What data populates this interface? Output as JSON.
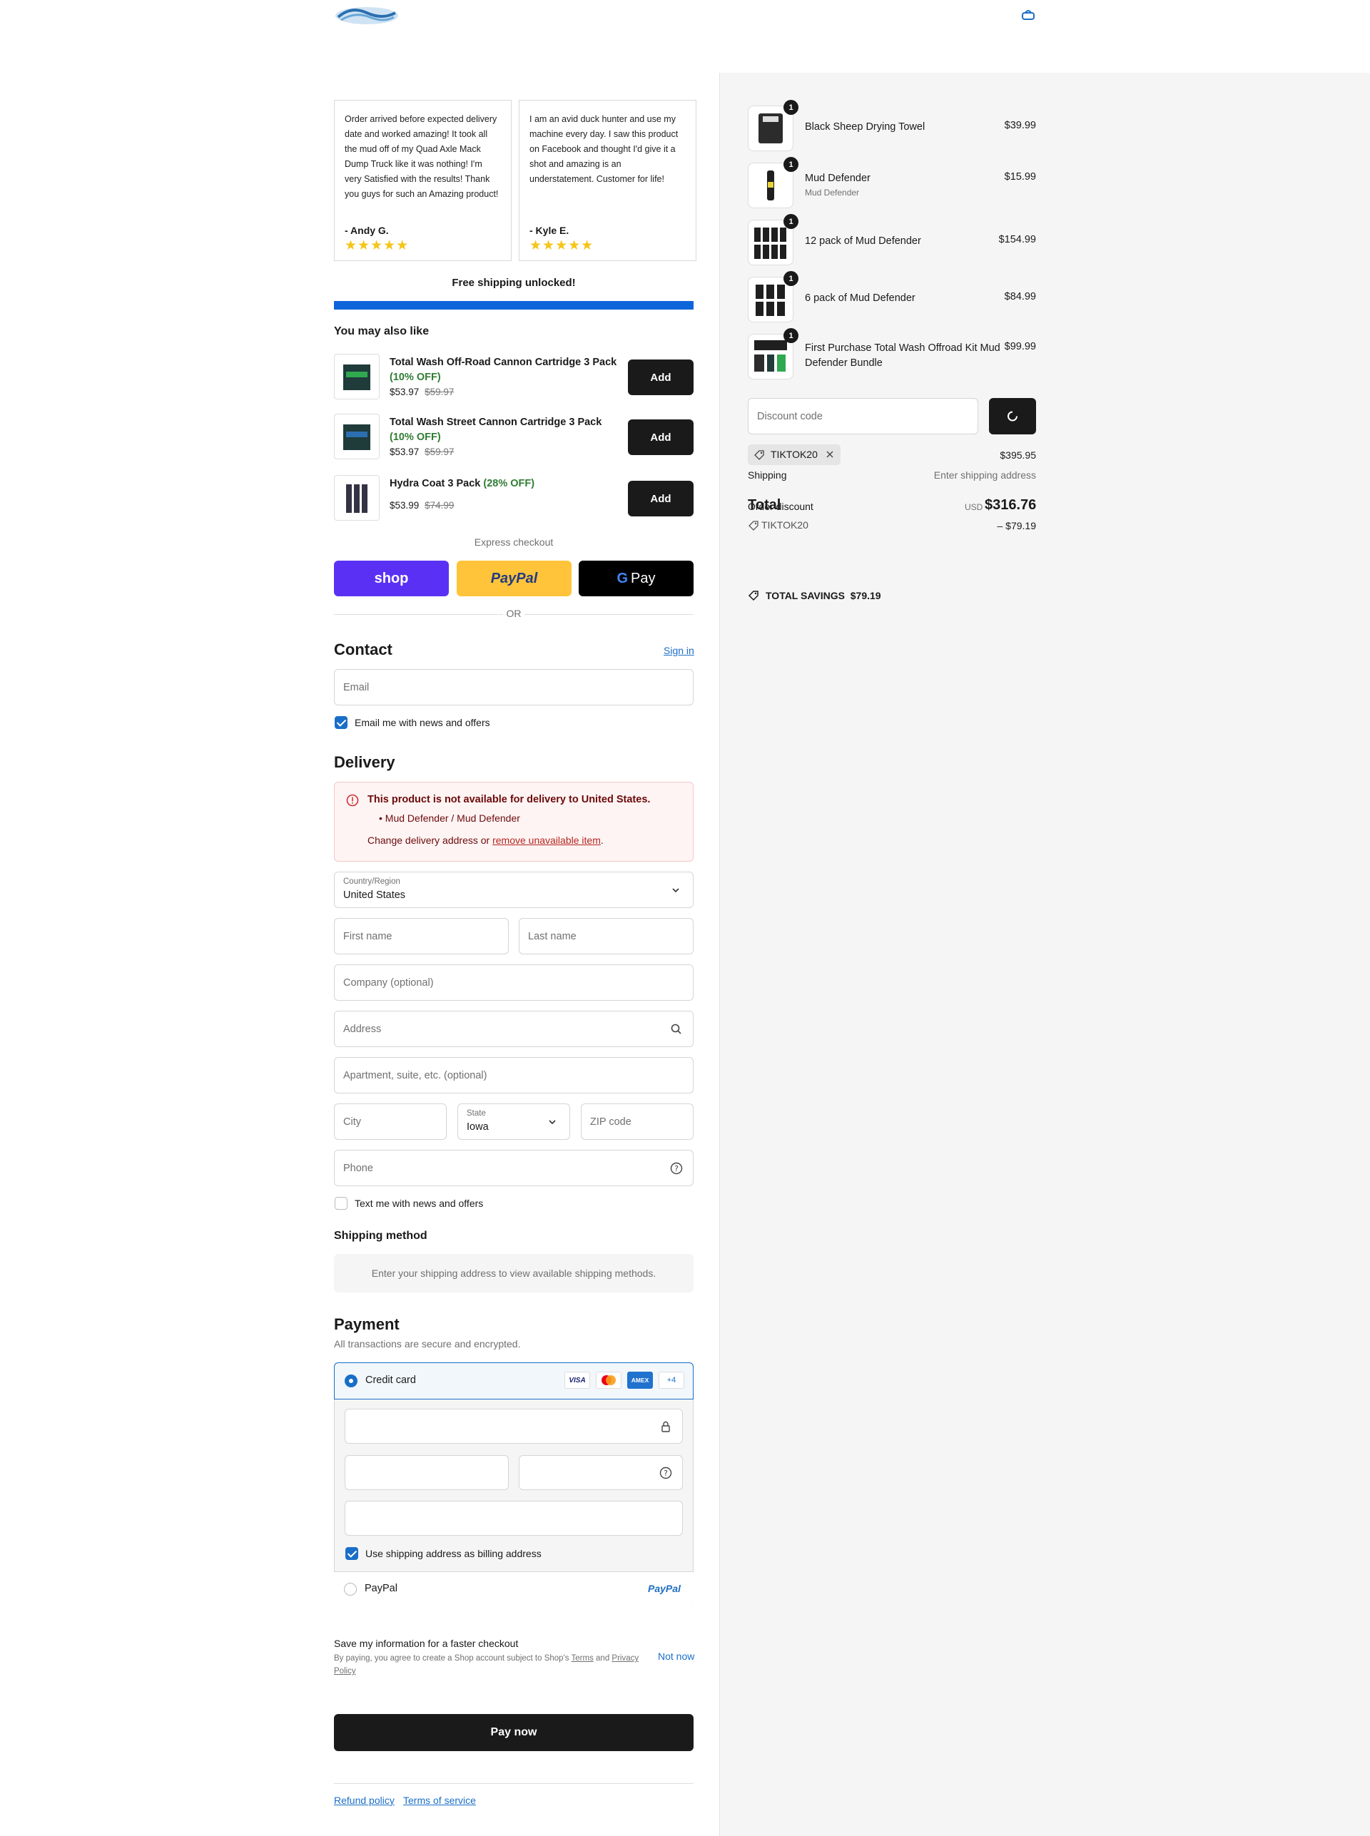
{
  "colors": {
    "accent": "#0d65d9",
    "link": "#1a6ec8",
    "dark_button": "#1a1a1a",
    "shop_pay": "#5a31f4",
    "paypal": "#ffc439",
    "error": "#d32f2f",
    "star": "#f5c518",
    "savings_green": "#2f7d32"
  },
  "header": {
    "logo_icon": "wave-logo-icon",
    "cart_icon": "shopping-bag-icon"
  },
  "reviews": [
    {
      "text": "Order arrived before expected delivery date and worked amazing! It took all the mud off of my Quad Axle Mack Dump Truck like it was nothing! I'm very Satisfied with the results! Thank you guys for such an Amazing product!",
      "author": "- Andy G.",
      "stars": "★★★★★"
    },
    {
      "text": "I am an avid duck hunter and use my machine every day. I saw this product on Facebook and thought I'd give it a shot and amazing is an understatement. Customer for life!",
      "author": "- Kyle E.",
      "stars": "★★★★★"
    }
  ],
  "shipping_progress": {
    "label": "Free shipping unlocked!",
    "progress": 1.0
  },
  "upsell": {
    "title": "You may also like",
    "items": [
      {
        "name": "Total Wash Off-Road Cannon Cartridge 3 Pack",
        "discount": "(10% OFF)",
        "price": "$53.97",
        "compare": "$59.97",
        "button": "Add"
      },
      {
        "name": "Total Wash Street Cannon Cartridge 3 Pack",
        "discount": "(10% OFF)",
        "price": "$53.97",
        "compare": "$59.97",
        "button": "Add"
      },
      {
        "name": "Hydra Coat 3 Pack",
        "discount": "(28% OFF)",
        "price": "$53.99",
        "compare": "$74.99",
        "button": "Add"
      }
    ]
  },
  "express": {
    "label": "Express checkout",
    "shop": "shop",
    "paypal": "PayPal",
    "gpay": "Pay",
    "or": "OR"
  },
  "contact": {
    "title": "Contact",
    "sign_in": "Sign in",
    "email_placeholder": "Email",
    "news_label": "Email me with news and offers"
  },
  "delivery": {
    "title": "Delivery",
    "warning_title": "This product is not available for delivery to United States.",
    "warning_item": "Mud Defender / Mud Defender",
    "warning_change": "Change delivery address or ",
    "warning_link": "remove unavailable item",
    "warning_end": ".",
    "country_label": "Country/Region",
    "country_value": "United States",
    "first_name": "First name",
    "last_name": "Last name",
    "company": "Company (optional)",
    "address": "Address",
    "apartment": "Apartment, suite, etc. (optional)",
    "city": "City",
    "state_label": "State",
    "state_value": "Iowa",
    "zip": "ZIP code",
    "phone": "Phone",
    "text_news": "Text me with news and offers"
  },
  "shipping_method": {
    "title": "Shipping method",
    "placeholder": "Enter your shipping address to view available shipping methods."
  },
  "payment": {
    "title": "Payment",
    "subtitle": "All transactions are secure and encrypted.",
    "credit_card": "Credit card",
    "card_brands": [
      "VISA",
      "",
      "AMEX",
      "+4"
    ],
    "billing_label": "Use shipping address as billing address",
    "paypal": "PayPal",
    "paypal_logo": "PayPal"
  },
  "save_info": {
    "title": "Save my information for a faster checkout",
    "terms_pre": "By paying, you agree to create a Shop account subject to Shop's ",
    "terms": "Terms",
    "and": " and ",
    "privacy": "Privacy Policy",
    "not_now": "Not now"
  },
  "pay_now": "Pay now",
  "footer": {
    "refund": "Refund policy",
    "tos": "Terms of service"
  },
  "summary": {
    "items": [
      {
        "name": "Black Sheep Drying Towel",
        "variant": "",
        "price": "$39.99",
        "qty": "1"
      },
      {
        "name": "Mud Defender",
        "variant": "Mud Defender",
        "price": "$15.99",
        "qty": "1"
      },
      {
        "name": "12 pack of Mud Defender",
        "variant": "",
        "price": "$154.99",
        "qty": "1"
      },
      {
        "name": "6 pack of Mud Defender",
        "variant": "",
        "price": "$84.99",
        "qty": "1"
      },
      {
        "name": "First Purchase Total Wash Offroad Kit Mud Defender Bundle",
        "variant": "",
        "price": "$99.99",
        "qty": "1"
      }
    ],
    "discount_placeholder": "Discount code",
    "discount_tag": "TIKTOK20",
    "subtotal": "$395.95",
    "shipping_label": "Shipping",
    "shipping_value": "Enter shipping address",
    "order_discount_label": "Order discount",
    "total_label": "Total",
    "currency": "USD",
    "total": "$316.76",
    "discount_code": "TIKTOK20",
    "discount_amount": "– $79.19",
    "savings_label": "TOTAL SAVINGS",
    "savings_value": "$79.19"
  }
}
